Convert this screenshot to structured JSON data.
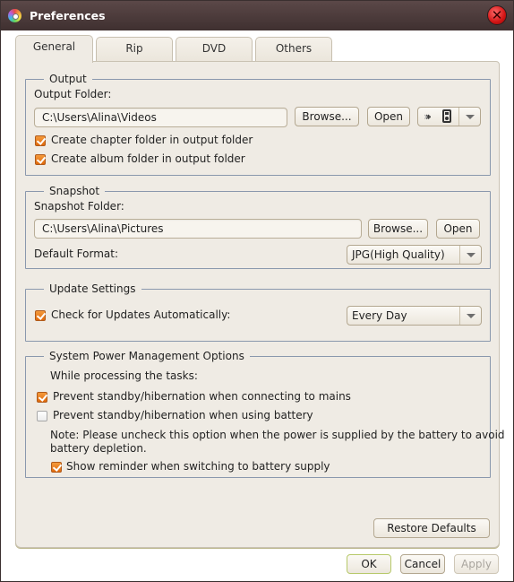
{
  "window": {
    "title": "Preferences",
    "close_label": "✕"
  },
  "tabs": [
    {
      "label": "General",
      "active": true
    },
    {
      "label": "Rip",
      "active": false
    },
    {
      "label": "DVD",
      "active": false
    },
    {
      "label": "Others",
      "active": false
    }
  ],
  "output": {
    "legend": "Output",
    "folder_label": "Output Folder:",
    "folder_value": "C:\\Users\\Alina\\Videos",
    "browse_label": "Browse...",
    "open_label": "Open",
    "device_icon": "portable-player-icon",
    "chapter_folder_label": "Create chapter folder in output folder",
    "chapter_folder_checked": true,
    "album_folder_label": "Create album folder in output folder",
    "album_folder_checked": true
  },
  "snapshot": {
    "legend": "Snapshot",
    "folder_label": "Snapshot Folder:",
    "folder_value": "C:\\Users\\Alina\\Pictures",
    "browse_label": "Browse...",
    "open_label": "Open",
    "format_label": "Default Format:",
    "format_value": "JPG(High Quality)"
  },
  "update": {
    "legend": "Update Settings",
    "auto_check_label": "Check for Updates Automatically:",
    "auto_check_checked": true,
    "frequency_value": "Every Day"
  },
  "power": {
    "legend": "System Power Management Options",
    "intro": "While processing the tasks:",
    "mains_label": "Prevent standby/hibernation when connecting to mains",
    "mains_checked": true,
    "battery_label": "Prevent standby/hibernation when using battery",
    "battery_checked": false,
    "note_line1": "Note: Please uncheck this option when the power is supplied by the battery to avoid",
    "note_line2": "battery depletion.",
    "reminder_label": "Show reminder when switching to battery supply",
    "reminder_checked": true
  },
  "footer": {
    "restore_label": "Restore Defaults",
    "ok_label": "OK",
    "cancel_label": "Cancel",
    "apply_label": "Apply"
  },
  "colors": {
    "titlebar": "#4a3a3a",
    "panel_bg": "#efebe4",
    "checkbox_accent": "#e8781c",
    "group_border": "#8a98ad"
  }
}
